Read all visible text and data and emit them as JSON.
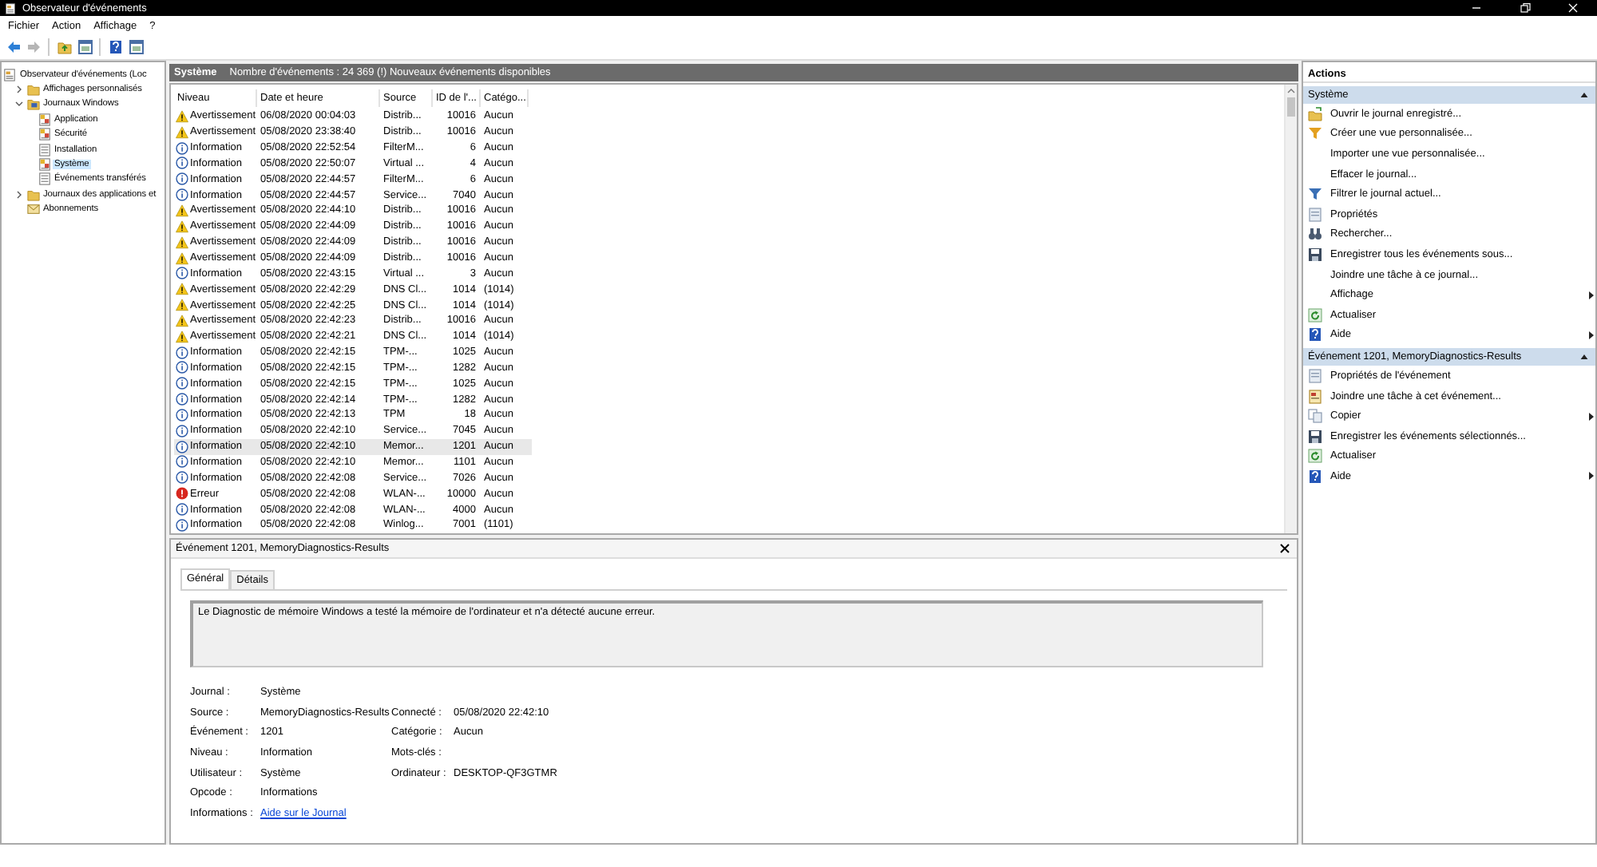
{
  "window": {
    "title": "Observateur d'événements"
  },
  "menu": [
    "Fichier",
    "Action",
    "Affichage",
    "?"
  ],
  "toolbar": [
    {
      "kind": "back",
      "disabled": false
    },
    {
      "kind": "forward",
      "disabled": true
    },
    {
      "kind": "folder-up",
      "disabled": false
    },
    {
      "kind": "panel",
      "disabled": false
    },
    {
      "kind": "help",
      "disabled": false
    },
    {
      "kind": "panel",
      "disabled": false
    }
  ],
  "tree": [
    {
      "label": "Observateur d'événements (Loc",
      "kind": "viewer",
      "selected": false,
      "children": [
        {
          "label": "Affichages personnalisés",
          "kind": "folder",
          "expanded": false,
          "selected": false
        },
        {
          "label": "Journaux Windows",
          "kind": "folder-log",
          "expanded": true,
          "selected": false,
          "children": [
            {
              "label": "Application",
              "kind": "log",
              "selected": false
            },
            {
              "label": "Sécurité",
              "kind": "log",
              "selected": false
            },
            {
              "label": "Installation",
              "kind": "page",
              "selected": false
            },
            {
              "label": "Système",
              "kind": "log",
              "selected": true
            },
            {
              "label": "Événements transférés",
              "kind": "page",
              "selected": false
            }
          ]
        },
        {
          "label": "Journaux des applications et",
          "kind": "folder",
          "expanded": false,
          "selected": false
        },
        {
          "label": "Abonnements",
          "kind": "subscription",
          "selected": false
        }
      ]
    }
  ],
  "list_header": {
    "title": "Système",
    "info": "Nombre d'événements : 24 369 (!) Nouveaux événements disponibles"
  },
  "table": {
    "columns": [
      "Niveau",
      "Date et heure",
      "Source",
      "ID de l'...",
      "Catégo..."
    ],
    "rows": [
      {
        "kind": "warning",
        "level_text": "Avertissement",
        "date": "06/08/2020 00:04:03",
        "source": "Distrib...",
        "id": "10016",
        "category": "Aucun",
        "selected": false
      },
      {
        "kind": "warning",
        "level_text": "Avertissement",
        "date": "05/08/2020 23:38:40",
        "source": "Distrib...",
        "id": "10016",
        "category": "Aucun",
        "selected": false
      },
      {
        "kind": "info",
        "level_text": "Information",
        "date": "05/08/2020 22:52:54",
        "source": "FilterM...",
        "id": "6",
        "category": "Aucun",
        "selected": false
      },
      {
        "kind": "info",
        "level_text": "Information",
        "date": "05/08/2020 22:50:07",
        "source": "Virtual ...",
        "id": "4",
        "category": "Aucun",
        "selected": false
      },
      {
        "kind": "info",
        "level_text": "Information",
        "date": "05/08/2020 22:44:57",
        "source": "FilterM...",
        "id": "6",
        "category": "Aucun",
        "selected": false
      },
      {
        "kind": "info",
        "level_text": "Information",
        "date": "05/08/2020 22:44:57",
        "source": "Service...",
        "id": "7040",
        "category": "Aucun",
        "selected": false
      },
      {
        "kind": "warning",
        "level_text": "Avertissement",
        "date": "05/08/2020 22:44:10",
        "source": "Distrib...",
        "id": "10016",
        "category": "Aucun",
        "selected": false
      },
      {
        "kind": "warning",
        "level_text": "Avertissement",
        "date": "05/08/2020 22:44:09",
        "source": "Distrib...",
        "id": "10016",
        "category": "Aucun",
        "selected": false
      },
      {
        "kind": "warning",
        "level_text": "Avertissement",
        "date": "05/08/2020 22:44:09",
        "source": "Distrib...",
        "id": "10016",
        "category": "Aucun",
        "selected": false
      },
      {
        "kind": "warning",
        "level_text": "Avertissement",
        "date": "05/08/2020 22:44:09",
        "source": "Distrib...",
        "id": "10016",
        "category": "Aucun",
        "selected": false
      },
      {
        "kind": "info",
        "level_text": "Information",
        "date": "05/08/2020 22:43:15",
        "source": "Virtual ...",
        "id": "3",
        "category": "Aucun",
        "selected": false
      },
      {
        "kind": "warning",
        "level_text": "Avertissement",
        "date": "05/08/2020 22:42:29",
        "source": "DNS Cl...",
        "id": "1014",
        "category": "(1014)",
        "selected": false
      },
      {
        "kind": "warning",
        "level_text": "Avertissement",
        "date": "05/08/2020 22:42:25",
        "source": "DNS Cl...",
        "id": "1014",
        "category": "(1014)",
        "selected": false
      },
      {
        "kind": "warning",
        "level_text": "Avertissement",
        "date": "05/08/2020 22:42:23",
        "source": "Distrib...",
        "id": "10016",
        "category": "Aucun",
        "selected": false
      },
      {
        "kind": "warning",
        "level_text": "Avertissement",
        "date": "05/08/2020 22:42:21",
        "source": "DNS Cl...",
        "id": "1014",
        "category": "(1014)",
        "selected": false
      },
      {
        "kind": "info",
        "level_text": "Information",
        "date": "05/08/2020 22:42:15",
        "source": "TPM-...",
        "id": "1025",
        "category": "Aucun",
        "selected": false
      },
      {
        "kind": "info",
        "level_text": "Information",
        "date": "05/08/2020 22:42:15",
        "source": "TPM-...",
        "id": "1282",
        "category": "Aucun",
        "selected": false
      },
      {
        "kind": "info",
        "level_text": "Information",
        "date": "05/08/2020 22:42:15",
        "source": "TPM-...",
        "id": "1025",
        "category": "Aucun",
        "selected": false
      },
      {
        "kind": "info",
        "level_text": "Information",
        "date": "05/08/2020 22:42:14",
        "source": "TPM-...",
        "id": "1282",
        "category": "Aucun",
        "selected": false
      },
      {
        "kind": "info",
        "level_text": "Information",
        "date": "05/08/2020 22:42:13",
        "source": "TPM",
        "id": "18",
        "category": "Aucun",
        "selected": false
      },
      {
        "kind": "info",
        "level_text": "Information",
        "date": "05/08/2020 22:42:10",
        "source": "Service...",
        "id": "7045",
        "category": "Aucun",
        "selected": false
      },
      {
        "kind": "info",
        "level_text": "Information",
        "date": "05/08/2020 22:42:10",
        "source": "Memor...",
        "id": "1201",
        "category": "Aucun",
        "selected": true
      },
      {
        "kind": "info",
        "level_text": "Information",
        "date": "05/08/2020 22:42:10",
        "source": "Memor...",
        "id": "1101",
        "category": "Aucun",
        "selected": false
      },
      {
        "kind": "info",
        "level_text": "Information",
        "date": "05/08/2020 22:42:08",
        "source": "Service...",
        "id": "7026",
        "category": "Aucun",
        "selected": false
      },
      {
        "kind": "error",
        "level_text": "Erreur",
        "date": "05/08/2020 22:42:08",
        "source": "WLAN-...",
        "id": "10000",
        "category": "Aucun",
        "selected": false
      },
      {
        "kind": "info",
        "level_text": "Information",
        "date": "05/08/2020 22:42:08",
        "source": "WLAN-...",
        "id": "4000",
        "category": "Aucun",
        "selected": false
      },
      {
        "kind": "info",
        "level_text": "Information",
        "date": "05/08/2020 22:42:08",
        "source": "Winlog...",
        "id": "7001",
        "category": "(1101)",
        "selected": false
      }
    ]
  },
  "detail": {
    "title": "Événement 1201, MemoryDiagnostics-Results",
    "tabs": [
      {
        "label": "Général",
        "selected": true
      },
      {
        "label": "Détails",
        "selected": false
      }
    ],
    "message": "Le Diagnostic de mémoire Windows a testé la mémoire de l'ordinateur et n'a détecté aucune erreur.",
    "properties": [
      {
        "left": {
          "label": "Journal :",
          "value": "Système"
        }
      },
      {
        "left": {
          "label": "Source :",
          "value": "MemoryDiagnostics-Results"
        },
        "right": {
          "label": "Connecté :",
          "value": "05/08/2020 22:42:10"
        }
      },
      {
        "left": {
          "label": "Événement :",
          "value": "1201"
        },
        "right": {
          "label": "Catégorie :",
          "value": "Aucun"
        }
      },
      {
        "left": {
          "label": "Niveau :",
          "value": "Information"
        },
        "right": {
          "label": "Mots-clés :"
        }
      },
      {
        "left": {
          "label": "Utilisateur :",
          "value": "Système"
        },
        "right": {
          "label": "Ordinateur :",
          "value": "DESKTOP-QF3GTMR"
        }
      },
      {
        "left": {
          "label": "Opcode :",
          "value": "Informations"
        }
      },
      {
        "left": {
          "label": "Informations :",
          "value": "Aide sur le Journal",
          "kind": "link"
        }
      }
    ]
  },
  "actions": {
    "title": "Actions",
    "sections": [
      {
        "title": "Système",
        "expanded": true,
        "items": [
          {
            "label": "Ouvrir le journal enregistré...",
            "kind": "open",
            "submenu": false
          },
          {
            "label": "Créer une vue personnalisée...",
            "kind": "filter-new",
            "submenu": false
          },
          {
            "label": "Importer une vue personnalisée...",
            "kind": "plain",
            "submenu": false
          },
          {
            "label": "Effacer le journal...",
            "kind": "plain",
            "submenu": false
          },
          {
            "label": "Filtrer le journal actuel...",
            "kind": "filter",
            "submenu": false
          },
          {
            "label": "Propriétés",
            "kind": "props",
            "submenu": false
          },
          {
            "label": "Rechercher...",
            "kind": "find",
            "submenu": false
          },
          {
            "label": "Enregistrer tous les événements sous...",
            "kind": "save",
            "submenu": false
          },
          {
            "label": "Joindre une tâche à ce journal...",
            "kind": "plain",
            "submenu": false
          },
          {
            "label": "Affichage",
            "kind": "plain",
            "submenu": true
          },
          {
            "label": "Actualiser",
            "kind": "refresh",
            "submenu": false
          },
          {
            "label": "Aide",
            "kind": "help",
            "submenu": true
          }
        ]
      },
      {
        "title": "Événement 1201, MemoryDiagnostics-Results",
        "expanded": true,
        "items": [
          {
            "label": "Propriétés de l'événement",
            "kind": "props",
            "submenu": false
          },
          {
            "label": "Joindre une tâche à cet événement...",
            "kind": "task",
            "submenu": false
          },
          {
            "label": "Copier",
            "kind": "copy",
            "submenu": true
          },
          {
            "label": "Enregistrer les événements sélectionnés...",
            "kind": "save",
            "submenu": false
          },
          {
            "label": "Actualiser",
            "kind": "refresh",
            "submenu": false
          },
          {
            "label": "Aide",
            "kind": "help",
            "submenu": true
          }
        ]
      }
    ]
  }
}
